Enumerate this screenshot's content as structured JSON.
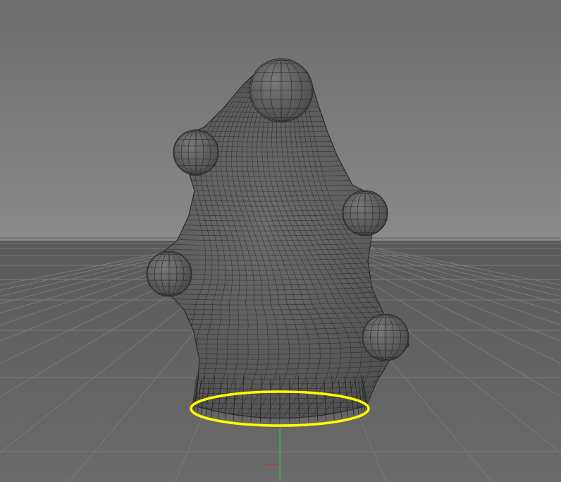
{
  "viewport": {
    "type": "3d-perspective",
    "background_sky": "#828282",
    "background_floor": "#5e5e5e",
    "grid_line_color": "#7a7a7a",
    "horizon_color": "#9b9b9b"
  },
  "scene": {
    "object": {
      "kind": "wireframe-mesh",
      "fill_color": "#5f5f5f",
      "wire_color": "#2a2a2a",
      "bumps": 6
    },
    "selection": {
      "kind": "base-circle-spline",
      "color": "#ffff00"
    },
    "axes": {
      "y_color": "#3fae3f",
      "x_color": "#c83a3a"
    }
  }
}
